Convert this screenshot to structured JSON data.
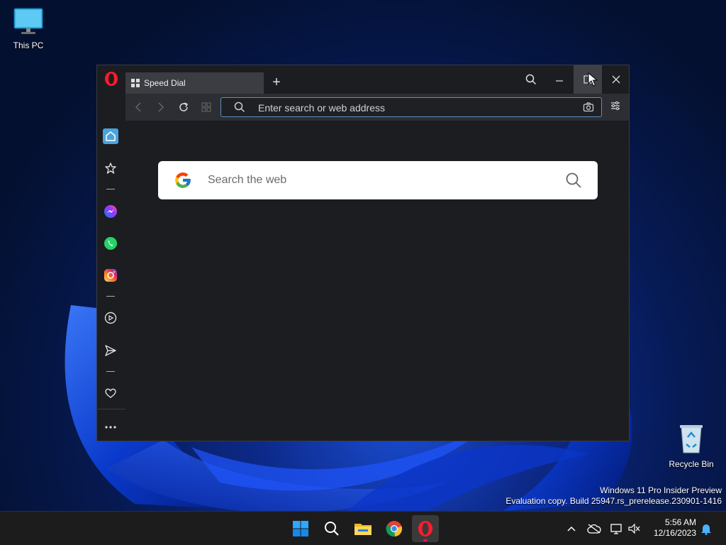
{
  "desktop": {
    "icons": [
      {
        "label": "This PC",
        "icon": "monitor-icon"
      },
      {
        "label": "Recycle Bin",
        "icon": "recycle-bin-icon"
      }
    ],
    "watermark_line1": "Windows 11 Pro Insider Preview",
    "watermark_line2": "Evaluation copy. Build 25947.rs_prerelease.230901-1416"
  },
  "browser": {
    "name": "Opera",
    "tab": {
      "title": "Speed Dial",
      "icon": "speed-dial-icon"
    },
    "address": {
      "placeholder": "Enter search or web address"
    },
    "google_search": {
      "placeholder": "Search the web"
    },
    "sidebar": [
      "home-icon",
      "bookmarks-icon",
      "messenger-icon",
      "whatsapp-icon",
      "instagram-icon",
      "player-icon",
      "send-icon",
      "heart-icon",
      "more-icon"
    ],
    "colors": {
      "accent": "#5a8fc4",
      "opera_red": "#ff1b2d"
    }
  },
  "taskbar": {
    "apps": [
      "start-icon",
      "search-icon",
      "file-explorer-icon",
      "chrome-icon",
      "opera-icon"
    ],
    "time": "5:56 AM",
    "date": "12/16/2023"
  }
}
